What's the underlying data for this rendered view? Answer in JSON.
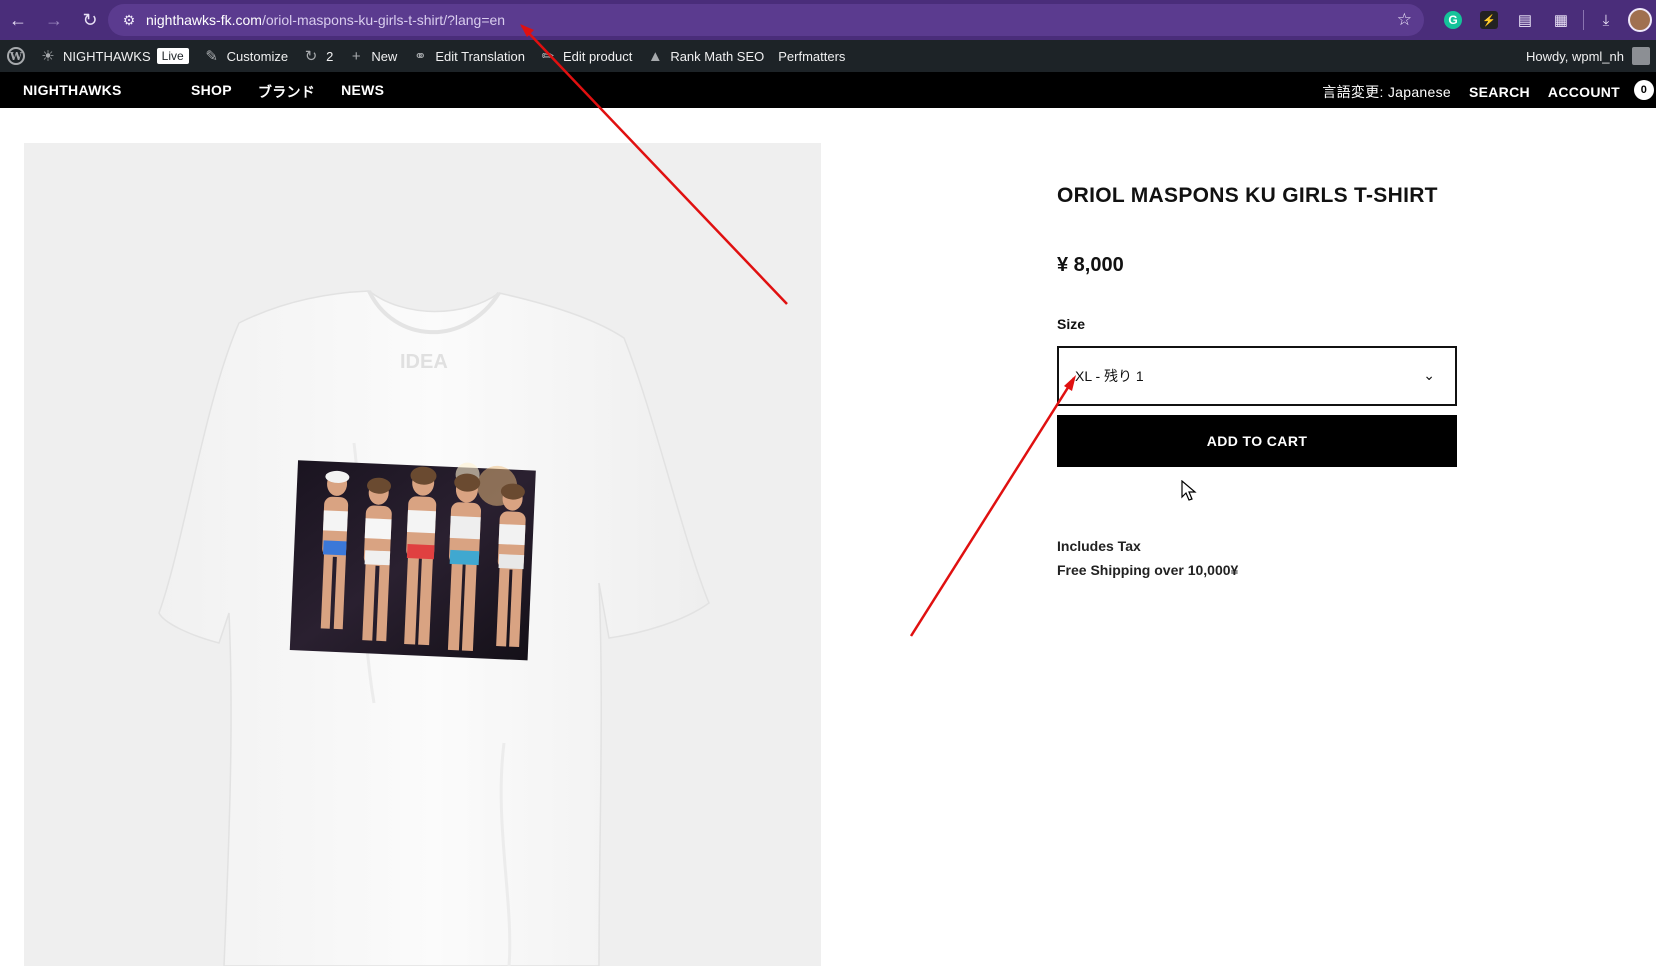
{
  "browser": {
    "url_host": "nighthawks-fk.com",
    "url_path": "/oriol-maspons-ku-girls-t-shirt/?lang=en",
    "icons": [
      "back-icon",
      "forward-icon",
      "reload-icon",
      "site-info-icon",
      "star-icon",
      "grammarly-icon",
      "bolt-extension-icon",
      "extension-icon",
      "puzzle-icon",
      "download-icon",
      "profile-avatar"
    ],
    "accent_color": "#4a2d7a"
  },
  "adminbar": {
    "site_name": "NIGHTHAWKS",
    "live_badge": "Live",
    "customize": "Customize",
    "updates_count": "2",
    "new": "New",
    "edit_translation": "Edit Translation",
    "edit_product": "Edit product",
    "rank_math": "Rank Math SEO",
    "perfmatters": "Perfmatters",
    "howdy": "Howdy, wpml_nh"
  },
  "header": {
    "brand": "NIGHTHAWKS",
    "nav": [
      "SHOP",
      "ブランド",
      "NEWS"
    ],
    "language": "言語変更: Japanese",
    "search": "SEARCH",
    "account": "ACCOUNT",
    "cart_count": "0"
  },
  "product": {
    "title": "ORIOL MASPONS KU GIRLS T-SHIRT",
    "price": "¥ 8,000",
    "size_label": "Size",
    "size_selected": "XL - 残り 1",
    "add_to_cart": "ADD TO CART",
    "note_tax": "Includes Tax",
    "note_shipping": "Free Shipping over 10,000¥",
    "image_shirt_logo": "IDEA"
  },
  "annotations": {
    "arrow_color": "#e01010"
  }
}
